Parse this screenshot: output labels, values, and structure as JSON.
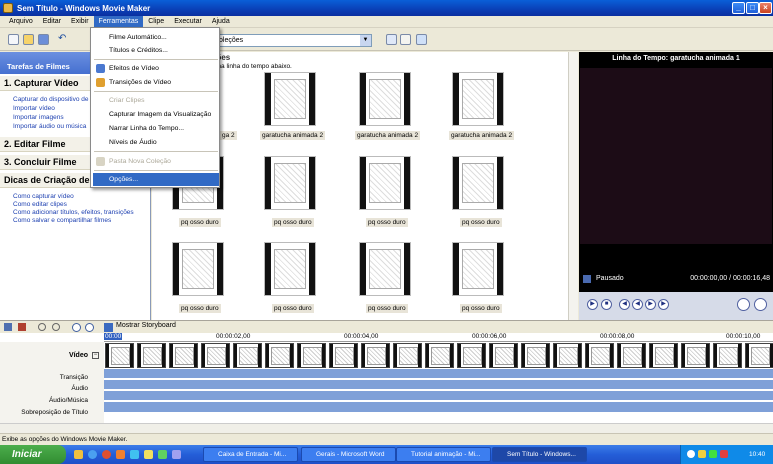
{
  "window": {
    "title": "Sem Título - Windows Movie Maker"
  },
  "menubar": [
    "Arquivo",
    "Editar",
    "Exibir",
    "Ferramentas",
    "Clipe",
    "Executar",
    "Ajuda"
  ],
  "toolbar": {
    "collection_fragment": "oleções"
  },
  "tools_menu": {
    "items": [
      {
        "label": "Filme Automático...",
        "disabled": false
      },
      {
        "label": "Títulos e Créditos...",
        "disabled": false
      },
      {
        "label": "Efeitos de Vídeo",
        "disabled": false
      },
      {
        "label": "Transições de Vídeo",
        "disabled": false
      },
      {
        "label": "Criar Clipes",
        "disabled": true
      },
      {
        "label": "Capturar Imagem da Visualização",
        "disabled": false
      },
      {
        "label": "Narrar Linha do Tempo...",
        "disabled": false
      },
      {
        "label": "Níveis de Áudio",
        "disabled": false
      },
      {
        "label": "Pasta Nova Coleção",
        "disabled": true
      },
      {
        "label": "Opções...",
        "disabled": false
      }
    ]
  },
  "taskpane": {
    "header": "Tarefas de Filmes",
    "capture": {
      "title": "1. Capturar Vídeo",
      "links": [
        "Capturar do dispositivo de vídeo",
        "Importar vídeo",
        "Importar imagens",
        "Importar áudio ou música"
      ]
    },
    "edit": {
      "title": "2. Editar Filme"
    },
    "finish": {
      "title": "3. Concluir Filme"
    },
    "tips": {
      "title": "Dicas de Criação de",
      "links": [
        "Como capturar vídeo",
        "Como editar clipes",
        "Como adicionar títulos, efeitos, transições",
        "Como salvar e compartilhar filmes"
      ]
    }
  },
  "content": {
    "title": "ções",
    "subtitle": "o na linha do tempo abaixo.",
    "labels": [
      "ga 2",
      "garatucha animada 2",
      "garatucha animada 2",
      "garatucha animada 2",
      "pq osso duro",
      "pq osso duro",
      "pq osso duro",
      "pq osso duro",
      "pq osso duro",
      "pq osso duro",
      "pq osso duro",
      "pq osso duro"
    ]
  },
  "preview": {
    "title": "Linha do Tempo: garatucha animada 1",
    "status": "Pausado",
    "time": "00:00:00,00 / 00:00:16,48"
  },
  "timeline": {
    "storyboard_label": "Mostrar Storyboard",
    "ruler": [
      "00:00",
      "00:00:02,00",
      "00:00:04,00",
      "00:00:06,00",
      "00:00:08,00",
      "00:00:10,00"
    ],
    "tracks": {
      "video": "Vídeo",
      "transition": "Transição",
      "audio": "Áudio",
      "audio_music": "Áudio/Música",
      "title_overlay": "Sobreposição de Título"
    }
  },
  "statusbar": "Exibe as opções do Windows Movie Maker.",
  "taskbar": {
    "start": "Iniciar",
    "tasks": [
      "Caixa de Entrada - Mi...",
      "Gerais - Microsoft Word",
      "Tutorial animação - Mi...",
      "Sem Título - Windows..."
    ],
    "clock": "10:40"
  }
}
